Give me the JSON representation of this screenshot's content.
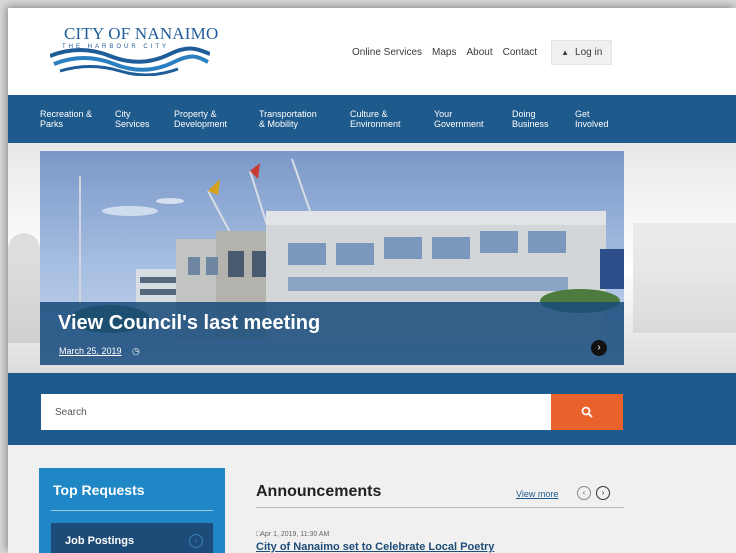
{
  "header": {
    "logo_title": "CITY OF NANAIMO",
    "logo_subtitle": "THE HARBOUR CITY",
    "utility_links": [
      "Online Services",
      "Maps",
      "About",
      "Contact"
    ],
    "login_label": "Log in",
    "login_icon": "user-icon"
  },
  "nav": {
    "items": [
      "Recreation &\nParks",
      "City\nServices",
      "Property &\nDevelopment",
      "Transportation\n& Mobility",
      "Culture &\nEnvironment",
      "Your\nGovernment",
      "Doing\nBusiness",
      "Get\nInvolved"
    ]
  },
  "hero": {
    "title": "View Council's last meeting",
    "date": "March 25, 2019",
    "clock_icon": "clock-icon",
    "next_icon": "chevron-right-circle-icon"
  },
  "search": {
    "placeholder": "Search",
    "button_icon": "search-icon"
  },
  "top_requests": {
    "title": "Top Requests",
    "items": [
      "Job Postings"
    ]
  },
  "announcements": {
    "title": "Announcements",
    "view_more": "View more",
    "items": [
      {
        "date": "Apr 1, 2019, 11:30 AM",
        "headline": "City of Nanaimo set to Celebrate Local Poetry"
      }
    ]
  },
  "colors": {
    "brand_blue": "#1f5a8c",
    "accent_orange": "#e9622b",
    "top_requests_blue": "#1f87c6"
  }
}
